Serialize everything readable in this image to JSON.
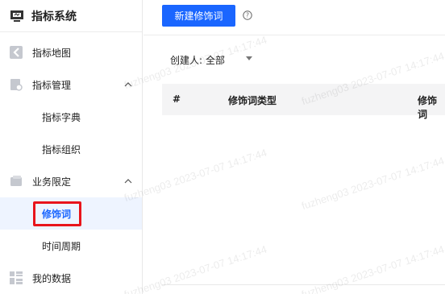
{
  "sidebar": {
    "brand": "指标系统",
    "items": [
      {
        "label": "指标地图",
        "icon": "map-icon"
      },
      {
        "label": "指标管理",
        "icon": "settings-doc-icon",
        "expanded": true
      },
      {
        "label": "指标字典",
        "sub": true
      },
      {
        "label": "指标组织",
        "sub": true
      },
      {
        "label": "业务限定",
        "icon": "folder-icon",
        "expanded": true
      },
      {
        "label": "修饰词",
        "sub": true,
        "active": true
      },
      {
        "label": "时间周期",
        "sub": true
      },
      {
        "label": "我的数据",
        "icon": "grid-icon"
      }
    ]
  },
  "toolbar": {
    "new_button": "新建修饰词",
    "help_icon": "question-circle-icon"
  },
  "filter": {
    "label": "创建人:",
    "value": "全部"
  },
  "table": {
    "columns": [
      "#",
      "修饰词类型",
      "修饰词"
    ]
  },
  "watermark": "fuzheng03 2023-07-07 14:17:44",
  "colors": {
    "primary": "#1a66ff",
    "highlight": "#e8141b",
    "active_bg": "#eef4ff"
  }
}
